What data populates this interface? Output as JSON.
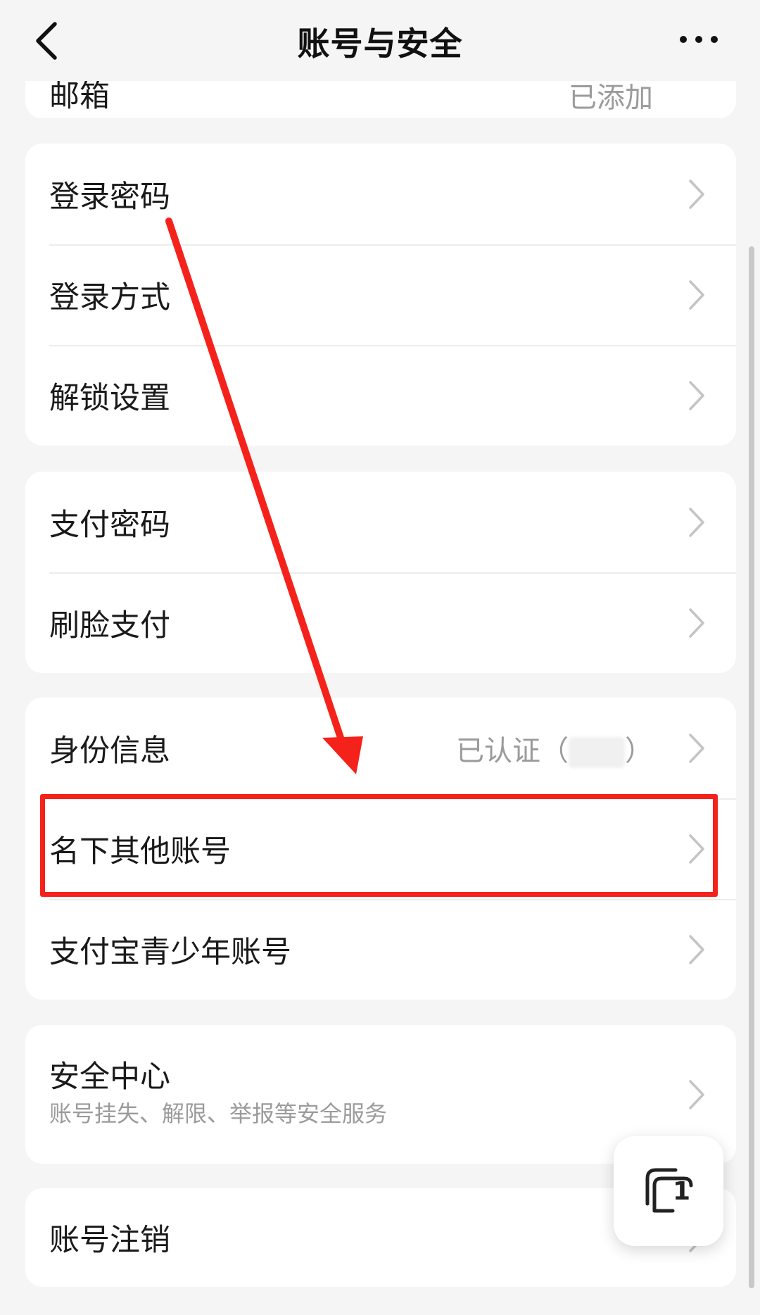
{
  "header": {
    "title": "账号与安全",
    "back_icon": "chevron-left-icon",
    "more_icon": "more-dots-icon"
  },
  "partial_row": {
    "label": "邮箱",
    "value": "已添加"
  },
  "groups": [
    {
      "rows": [
        {
          "label": "登录密码"
        },
        {
          "label": "登录方式"
        },
        {
          "label": "解锁设置"
        }
      ]
    },
    {
      "rows": [
        {
          "label": "支付密码"
        },
        {
          "label": "刷脸支付"
        }
      ]
    },
    {
      "rows": [
        {
          "label": "身份信息",
          "value_prefix": "已认证（",
          "value_suffix": "）"
        },
        {
          "label": "名下其他账号"
        },
        {
          "label": "支付宝青少年账号"
        }
      ]
    },
    {
      "rows": [
        {
          "label": "安全中心",
          "subtitle": "账号挂失、解限、举报等安全服务"
        }
      ]
    },
    {
      "rows": [
        {
          "label": "账号注销"
        }
      ]
    }
  ],
  "floating_button": {
    "icon": "window-stack-icon",
    "count": "1"
  },
  "annotation": {
    "color": "#f5221b",
    "highlighted_item": "名下其他账号"
  }
}
